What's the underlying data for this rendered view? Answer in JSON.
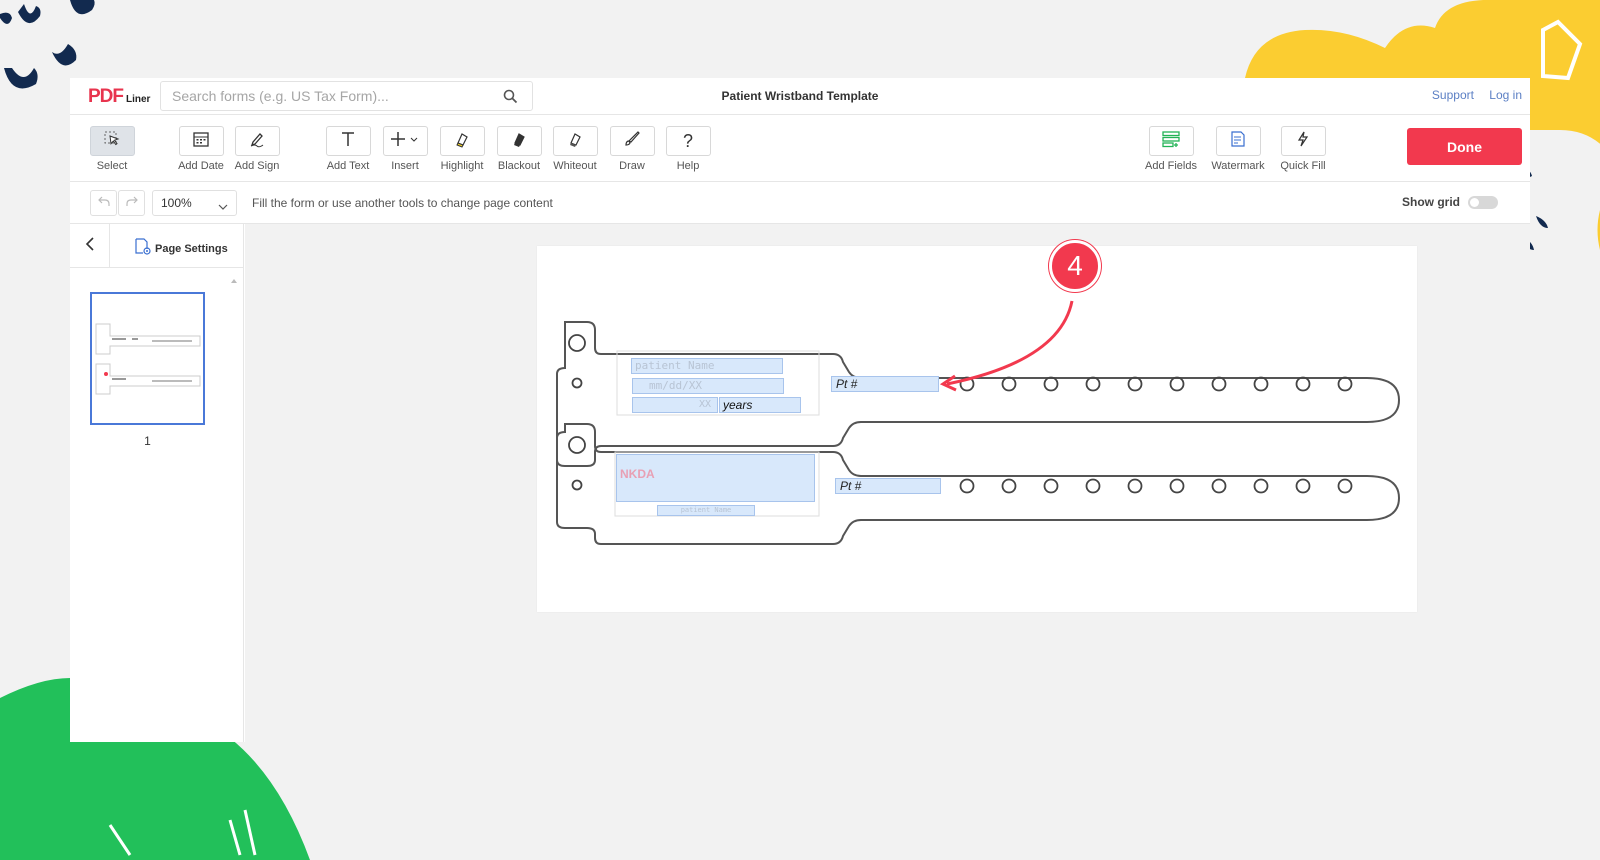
{
  "header": {
    "logo_text": "PDF",
    "logo_sub": "Liner",
    "search_placeholder": "Search forms (e.g. US Tax Form)...",
    "doc_title": "Patient Wristband Template",
    "links": [
      "Support",
      "Log in"
    ]
  },
  "toolbar": {
    "tools": [
      {
        "label": "Select",
        "icon": "cursor-icon"
      },
      {
        "label": "Add Date",
        "icon": "calendar-icon"
      },
      {
        "label": "Add Sign",
        "icon": "pen-sign-icon"
      },
      {
        "label": "Add Text",
        "icon": "text-icon"
      },
      {
        "label": "Insert",
        "icon": "plus-icon"
      },
      {
        "label": "Highlight",
        "icon": "highlighter-icon"
      },
      {
        "label": "Blackout",
        "icon": "blackout-icon"
      },
      {
        "label": "Whiteout",
        "icon": "eraser-icon"
      },
      {
        "label": "Draw",
        "icon": "brush-icon"
      },
      {
        "label": "Help",
        "icon": "question-icon"
      },
      {
        "label": "Add Fields",
        "icon": "fields-icon"
      },
      {
        "label": "Watermark",
        "icon": "watermark-icon"
      },
      {
        "label": "Quick Fill",
        "icon": "lightning-icon"
      }
    ],
    "done_label": "Done"
  },
  "subbar": {
    "zoom": "100%",
    "hint": "Fill the form or use another tools to change page content",
    "show_grid_label": "Show grid",
    "show_grid": false
  },
  "sidebar": {
    "page_settings_label": "Page Settings",
    "pages": [
      "1"
    ]
  },
  "document": {
    "band1": {
      "name_placeholder": "patient Name",
      "dob_placeholder": "mm/dd/XX",
      "age_placeholder": "XX",
      "age_suffix": "years",
      "pt_label": "Pt #"
    },
    "band2": {
      "allergy_placeholder": "NKDA",
      "name_placeholder": "patient Name",
      "pt_label": "Pt #"
    }
  },
  "annotation": {
    "step": "4",
    "color": "#f2394e"
  },
  "colors": {
    "accent": "#f2394e",
    "link": "#5b7fc4",
    "field_fill": "#d8e8fb",
    "thumb_border": "#4a78d8"
  }
}
